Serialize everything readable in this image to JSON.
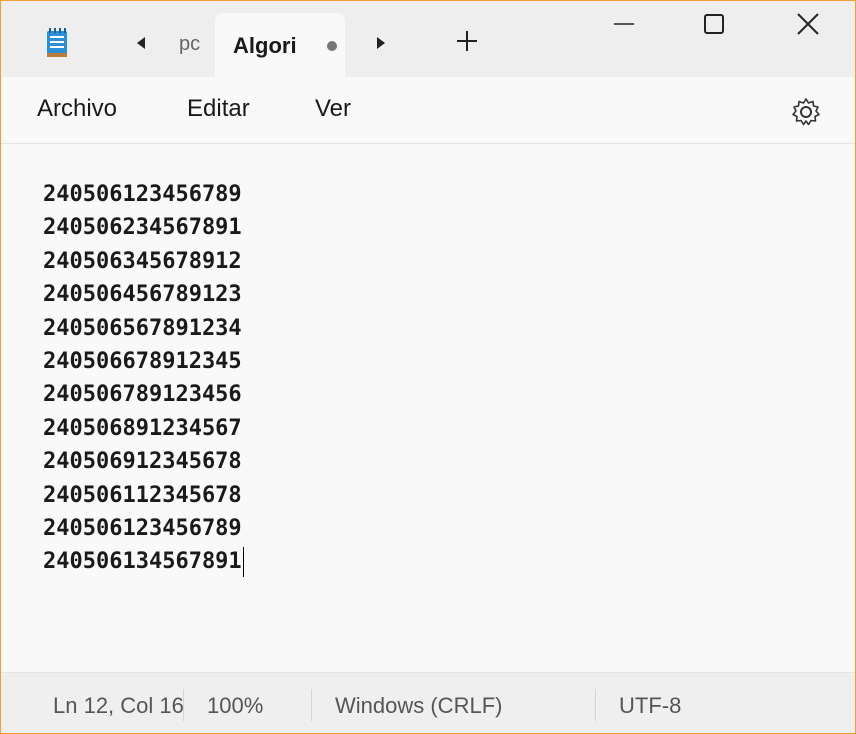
{
  "titlebar": {
    "app_icon": "notepad-icon",
    "prev_tab_icon": "chevron-left-icon",
    "next_tab_icon": "chevron-right-icon",
    "inactive_tab_label": "pc",
    "active_tab_label": "Algori",
    "unsaved_indicator": "unsaved-dot",
    "new_tab_icon": "plus-icon",
    "window_controls": [
      "minimize-icon",
      "maximize-icon",
      "close-icon"
    ]
  },
  "menubar": {
    "items": [
      "Archivo",
      "Editar",
      "Ver"
    ],
    "settings_icon": "gear-icon"
  },
  "editor": {
    "lines": [
      "240506123456789",
      "240506234567891",
      "240506345678912",
      "240506456789123",
      "240506567891234",
      "240506678912345",
      "240506789123456",
      "240506891234567",
      "240506912345678",
      "240506112345678",
      "240506123456789",
      "240506134567891"
    ]
  },
  "statusbar": {
    "position": "Ln 12, Col 16",
    "zoom": "100%",
    "line_ending": "Windows (CRLF)",
    "encoding": "UTF-8"
  },
  "colors": {
    "window_border": "#f0a030",
    "titlebar_bg": "#eeeeee",
    "editor_bg": "#f9f9f9",
    "text": "#1a1a1a",
    "icon_blue": "#2a8fd8"
  }
}
